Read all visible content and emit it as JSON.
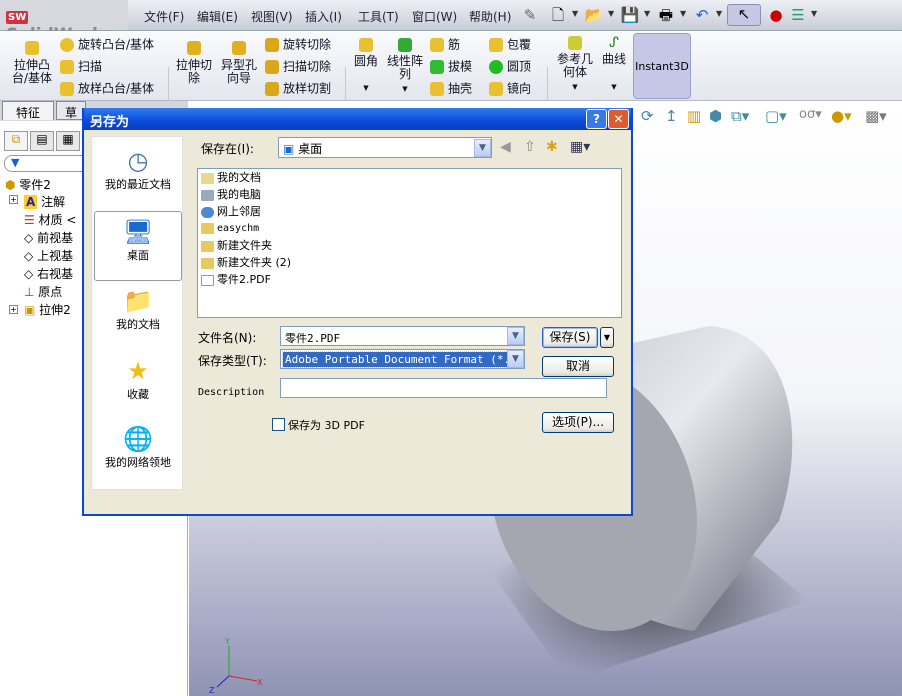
{
  "app": {
    "logo": "SolidWorks"
  },
  "menu": [
    "文件(F)",
    "编辑(E)",
    "视图(V)",
    "插入(I)",
    "工具(T)",
    "窗口(W)",
    "帮助(H)"
  ],
  "ribbon": {
    "extrude_boss": "拉伸凸台/基体",
    "revolve_boss": "旋转凸台/基体",
    "sweep": "扫描",
    "loft_boss": "放样凸台/基体",
    "extrude_cut": "拉伸切除",
    "hole_wizard": "异型孔向导",
    "revolve_cut": "旋转切除",
    "sweep_cut": "扫描切除",
    "loft_cut": "放样切割",
    "fillet": "圆角",
    "linear_pattern": "线性阵列",
    "rib": "筋",
    "draft": "拔模",
    "shell": "抽壳",
    "wrap": "包覆",
    "dome": "圆顶",
    "mirror": "镜向",
    "ref_geometry": "参考几何体",
    "curves": "曲线",
    "instant3d": "Instant3D"
  },
  "panel": {
    "tab_features": "特征",
    "tab_sketch": "草",
    "tree": [
      {
        "label": "零件2"
      },
      {
        "label": "注解"
      },
      {
        "label": "材质 <"
      },
      {
        "label": "前视基"
      },
      {
        "label": "上视基"
      },
      {
        "label": "右视基"
      },
      {
        "label": "原点"
      },
      {
        "label": "拉伸2"
      }
    ]
  },
  "dialog": {
    "title": "另存为",
    "help": "?",
    "places": [
      "我的最近文档",
      "桌面",
      "我的文档",
      "收藏",
      "我的网络领地"
    ],
    "save_in_label": "保存在(I):",
    "save_in_value": "桌面",
    "files": [
      "我的文档",
      "我的电脑",
      "网上邻居",
      "easychm",
      "新建文件夹",
      "新建文件夹 (2)",
      "零件2.PDF"
    ],
    "filename_label": "文件名(N):",
    "filename_value": "零件2.PDF",
    "filetype_label": "保存类型(T):",
    "filetype_value": "Adobe Portable Document Format (*.pdf)",
    "description_label": "Description",
    "description_value": "",
    "save_3d_label": "保存为 3D PDF",
    "save_3d_checked": false,
    "save_button": "保存(S)",
    "cancel_button": "取消",
    "options_button": "选项(P)..."
  },
  "colors": {
    "title_bar": "#0a4bd8",
    "selection": "#316ac5"
  }
}
